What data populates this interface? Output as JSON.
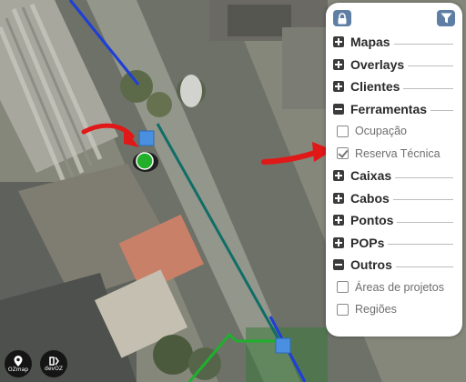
{
  "panel": {
    "sections": [
      {
        "label": "Mapas",
        "state": "collapsed"
      },
      {
        "label": "Overlays",
        "state": "collapsed"
      },
      {
        "label": "Clientes",
        "state": "collapsed"
      },
      {
        "label": "Ferramentas",
        "state": "expanded",
        "items": [
          {
            "label": "Ocupação",
            "checked": false
          },
          {
            "label": "Reserva Técnica",
            "checked": true
          }
        ]
      },
      {
        "label": "Caixas",
        "state": "collapsed"
      },
      {
        "label": "Cabos",
        "state": "collapsed"
      },
      {
        "label": "Pontos",
        "state": "collapsed"
      },
      {
        "label": "POPs",
        "state": "collapsed"
      },
      {
        "label": "Outros",
        "state": "expanded",
        "items": [
          {
            "label": "Áreas de projetos",
            "checked": false
          },
          {
            "label": "Regiões",
            "checked": false
          }
        ]
      }
    ],
    "top_icons": [
      "lock-icon",
      "filter-icon"
    ]
  },
  "logos": [
    {
      "icon": "ozmap-logo",
      "text": "OZmap"
    },
    {
      "icon": "devoz-logo",
      "text": "devOZ"
    }
  ],
  "colors": {
    "blue_cable": "#1f3fd6",
    "teal_cable": "#0f6e66",
    "green_region": "#1fb02e",
    "box_marker": "#4a8fe0",
    "reserve_marker": "#22b02a",
    "arrow": "#e01818",
    "panel_button": "#5e7ea3"
  }
}
